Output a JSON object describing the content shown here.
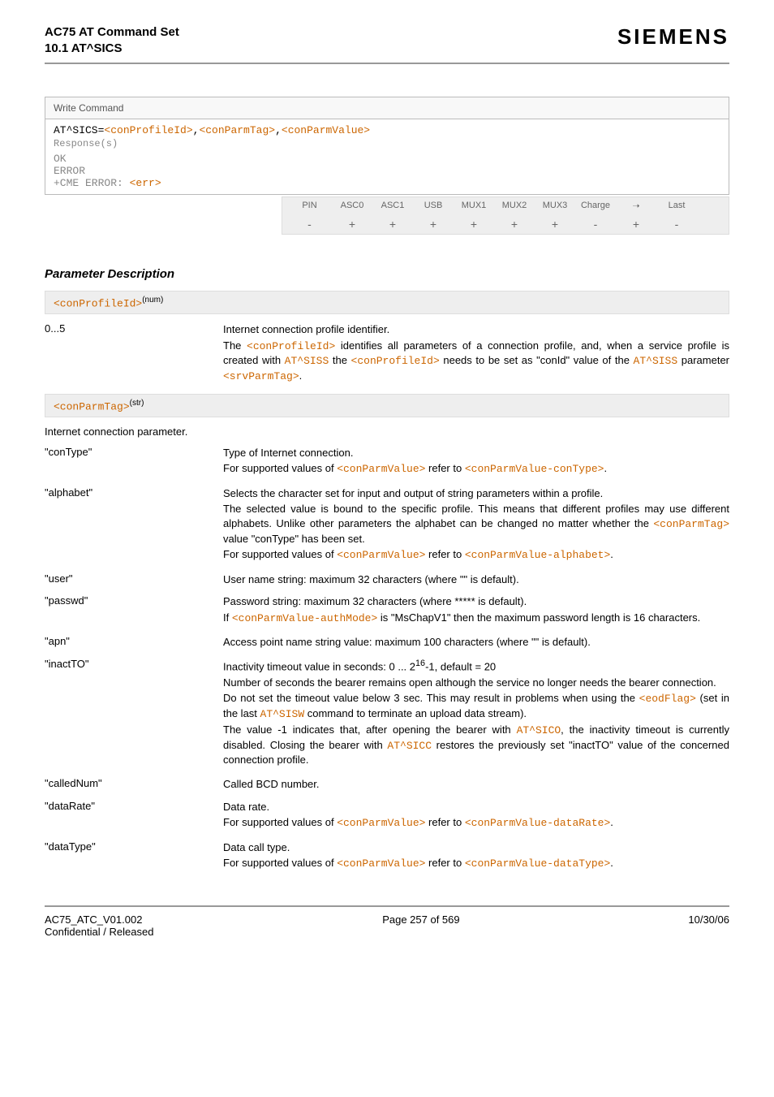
{
  "header": {
    "title1": "AC75 AT Command Set",
    "title2": "10.1 AT^SICS",
    "brand": "SIEMENS"
  },
  "writeCmd": {
    "label": "Write Command",
    "syntax_pre": "AT^SICS=",
    "p1": "<conProfileId>",
    "c1": ",",
    "p2": "<conParmTag>",
    "c2": ",",
    "p3": "<conParmValue>",
    "resp_label": "Response(s)",
    "r1": "OK",
    "r2": "ERROR",
    "r3a": "+CME ERROR: ",
    "r3b": "<err>"
  },
  "grid": {
    "h": [
      "PIN",
      "ASC0",
      "ASC1",
      "USB",
      "MUX1",
      "MUX2",
      "MUX3",
      "Charge",
      "➝",
      "Last"
    ],
    "v": [
      "-",
      "+",
      "+",
      "+",
      "+",
      "+",
      "+",
      "-",
      "+",
      "-"
    ]
  },
  "section": "Parameter Description",
  "param1": {
    "head_name": "<conProfileId>",
    "head_sup": "(num)",
    "left": "0...5",
    "r1": "Internet connection profile identifier.",
    "r2a": "The ",
    "r2b": "<conProfileId>",
    "r2c": " identifies all parameters of a connection profile, and, when a service profile is created with ",
    "r2d": "AT^SISS",
    "r2e": " the ",
    "r2f": "<conProfileId>",
    "r2g": " needs to be set as \"conId\" value of the ",
    "r2h": "AT^SISS",
    "r2i": " parameter ",
    "r2j": "<srvParmTag>",
    "r2k": "."
  },
  "param2": {
    "head_name": "<conParmTag>",
    "head_sup": "(str)",
    "intro": "Internet connection parameter.",
    "items": [
      {
        "name": "\"conType\"",
        "l1": "Type of Internet connection.",
        "l2a": "For supported values of ",
        "l2b": "<conParmValue>",
        "l2c": " refer to ",
        "l2d": "<conParmValue-conType>",
        "l2e": "."
      },
      {
        "name": "\"alphabet\"",
        "l1": "Selects the character set for input and output of string parameters within a profile.",
        "l2a": "The selected value is bound to the specific profile. This means that different profiles may use different alphabets. Unlike other parameters the alphabet can be changed no matter whether the ",
        "l2b": "<conParmTag>",
        "l2c": " value \"conType\" has been set.",
        "l3a": "For supported values of ",
        "l3b": "<conParmValue>",
        "l3c": " refer to ",
        "l3d": "<conParmValue-alphabet>",
        "l3e": "."
      },
      {
        "name": "\"user\"",
        "l1": "User name string: maximum 32 characters (where \"\" is default)."
      },
      {
        "name": "\"passwd\"",
        "l1": "Password string: maximum 32 characters (where ***** is default).",
        "l2a": "If ",
        "l2b": "<conParmValue-authMode>",
        "l2c": " is \"MsChapV1\" then the maximum password length is 16 characters."
      },
      {
        "name": "\"apn\"",
        "l1": "Access point name string value: maximum 100 characters (where \"\" is default)."
      },
      {
        "name": "\"inactTO\"",
        "l1a": "Inactivity timeout value in seconds: 0 ... 2",
        "l1sup": "16",
        "l1b": "-1, default = 20",
        "l2": "Number of seconds the bearer remains open although the service no longer needs the bearer connection.",
        "l3a": "Do not set the timeout value below 3 sec. This may result in problems when using the ",
        "l3b": "<eodFlag>",
        "l3c": " (set in the last ",
        "l3d": "AT^SISW",
        "l3e": " command to terminate an upload data stream).",
        "l4a": "The value -1 indicates that, after opening the bearer with ",
        "l4b": "AT^SICO",
        "l4c": ", the inactivity timeout is currently disabled. Closing the bearer with ",
        "l4d": "AT^SICC",
        "l4e": " restores the previously set \"inactTO\" value of the concerned connection profile."
      },
      {
        "name": "\"calledNum\"",
        "l1": "Called BCD number."
      },
      {
        "name": "\"dataRate\"",
        "l1": "Data rate.",
        "l2a": "For supported values of ",
        "l2b": "<conParmValue>",
        "l2c": " refer to ",
        "l2d": "<conParmValue-dataRate>",
        "l2e": "."
      },
      {
        "name": "\"dataType\"",
        "l1": "Data call type.",
        "l2a": "For supported values of ",
        "l2b": "<conParmValue>",
        "l2c": " refer to ",
        "l2d": "<conParmValue-dataType>",
        "l2e": "."
      }
    ]
  },
  "footer": {
    "left1": "AC75_ATC_V01.002",
    "left2": "Confidential / Released",
    "center": "Page 257 of 569",
    "right": "10/30/06"
  }
}
